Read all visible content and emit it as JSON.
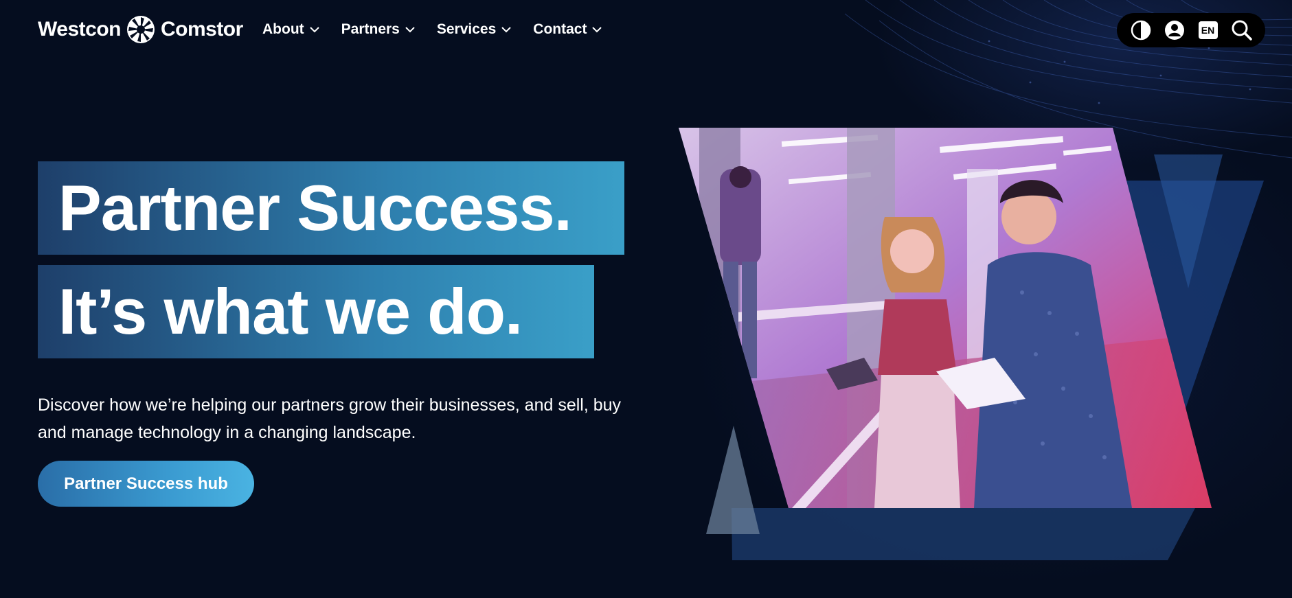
{
  "brand": {
    "name_left": "Westcon",
    "name_right": "Comstor",
    "logo_icon": "aperture-logo-icon"
  },
  "nav": {
    "items": [
      {
        "label": "About"
      },
      {
        "label": "Partners"
      },
      {
        "label": "Services"
      },
      {
        "label": "Contact"
      }
    ]
  },
  "utility": {
    "contrast_icon": "contrast-icon",
    "account_icon": "user-icon",
    "language": "EN",
    "search_icon": "search-icon"
  },
  "hero": {
    "headline_line1": "Partner Success.",
    "headline_line2": "It’s what we do.",
    "description": "Discover how we’re helping our partners grow their businesses, and sell, buy and manage technology in a changing landscape.",
    "cta_label": "Partner Success hub"
  },
  "colors": {
    "background": "#050d1f",
    "headline_gradient_start": "#1e3f6a",
    "headline_gradient_end": "#3a9fc8",
    "cta_gradient_start": "#2a6ea8",
    "cta_gradient_end": "#4ab3e2",
    "accent_navy": "#1a3766"
  }
}
